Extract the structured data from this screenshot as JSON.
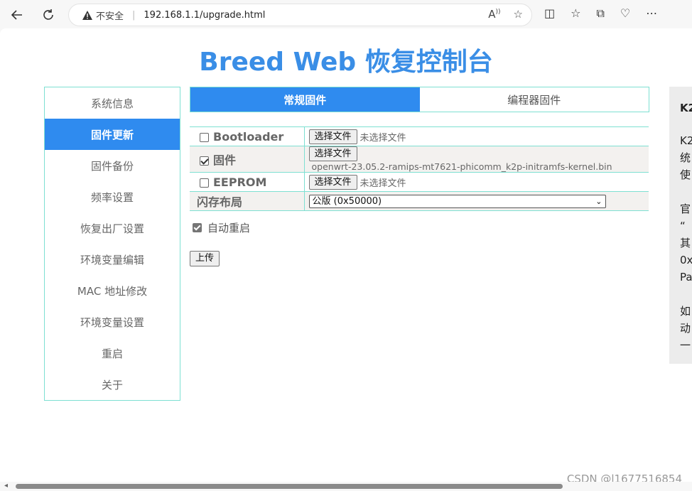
{
  "browser": {
    "insecure_label": "不安全",
    "url": "192.168.1.1/upgrade.html"
  },
  "page": {
    "title": "Breed Web 恢复控制台"
  },
  "sidebar": {
    "items": [
      {
        "label": "系统信息"
      },
      {
        "label": "固件更新"
      },
      {
        "label": "固件备份"
      },
      {
        "label": "频率设置"
      },
      {
        "label": "恢复出厂设置"
      },
      {
        "label": "环境变量编辑"
      },
      {
        "label": "MAC 地址修改"
      },
      {
        "label": "环境变量设置"
      },
      {
        "label": "重启"
      },
      {
        "label": "关于"
      }
    ],
    "active_index": 1
  },
  "tabs": [
    {
      "label": "常规固件"
    },
    {
      "label": "编程器固件"
    }
  ],
  "firmware_form": {
    "rows": [
      {
        "label": "Bootloader",
        "checked": false,
        "button": "选择文件",
        "file": "未选择文件"
      },
      {
        "label": "固件",
        "checked": true,
        "button": "选择文件",
        "file": "openwrt-23.05.2-ramips-mt7621-phicomm_k2p-initramfs-kernel.bin"
      },
      {
        "label": "EEPROM",
        "checked": false,
        "button": "选择文件",
        "file": "未选择文件"
      }
    ],
    "layout_label": "闪存布局",
    "layout_value": "公版 (0x50000)",
    "auto_reboot_label": "自动重启",
    "auto_reboot_checked": true,
    "upload_label": "上传"
  },
  "help_panel": {
    "heading": "K2",
    "lines": [
      "K2",
      "统",
      "使",
      "官",
      "“",
      "其",
      "0x",
      "Pa",
      "如",
      "动",
      "一"
    ]
  },
  "watermark": "CSDN @l1677516854"
}
